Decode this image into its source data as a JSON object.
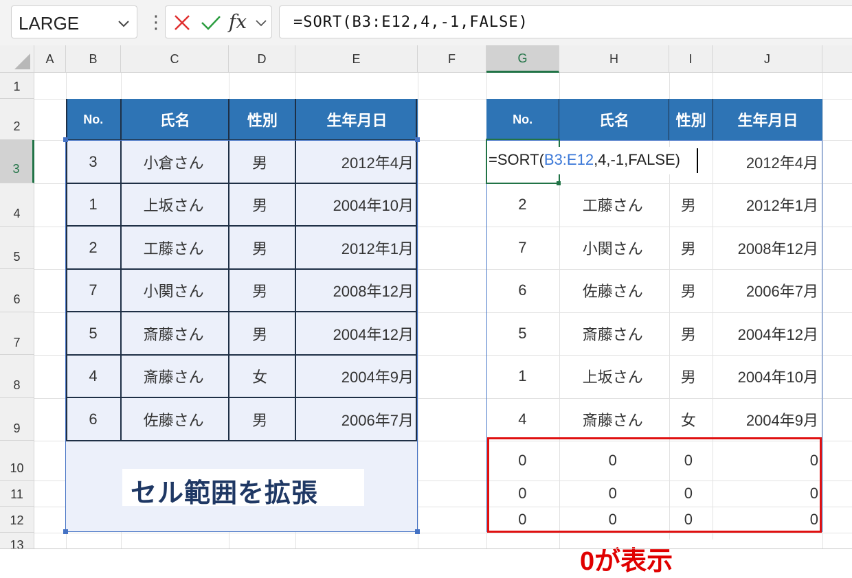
{
  "formula_bar": {
    "name_box": "LARGE",
    "fx_label": "fx",
    "formula": "=SORT(B3:E12,4,-1,FALSE)"
  },
  "columns": [
    "A",
    "B",
    "C",
    "D",
    "E",
    "F",
    "G",
    "H",
    "I",
    "J"
  ],
  "rows": [
    "1",
    "2",
    "3",
    "4",
    "5",
    "6",
    "7",
    "8",
    "9",
    "10",
    "11",
    "12",
    "13"
  ],
  "source_table": {
    "headers": [
      "No.",
      "氏名",
      "性別",
      "生年月日"
    ],
    "rows": [
      [
        "3",
        "小倉さん",
        "男",
        "2012年4月"
      ],
      [
        "1",
        "上坂さん",
        "男",
        "2004年10月"
      ],
      [
        "2",
        "工藤さん",
        "男",
        "2012年1月"
      ],
      [
        "7",
        "小関さん",
        "男",
        "2008年12月"
      ],
      [
        "5",
        "斎藤さん",
        "男",
        "2004年12月"
      ],
      [
        "4",
        "斎藤さん",
        "女",
        "2004年9月"
      ],
      [
        "6",
        "佐藤さん",
        "男",
        "2006年7月"
      ]
    ]
  },
  "result_table": {
    "headers": [
      "No.",
      "氏名",
      "性別",
      "生年月日"
    ],
    "editing": {
      "prefix": "=SORT(",
      "ref": "B3:E12",
      "suffix": ",4,-1,FALSE)",
      "e3": "2012年4月"
    },
    "rows": [
      [
        "2",
        "工藤さん",
        "男",
        "2012年1月"
      ],
      [
        "7",
        "小関さん",
        "男",
        "2008年12月"
      ],
      [
        "6",
        "佐藤さん",
        "男",
        "2006年7月"
      ],
      [
        "5",
        "斎藤さん",
        "男",
        "2004年12月"
      ],
      [
        "1",
        "上坂さん",
        "男",
        "2004年10月"
      ],
      [
        "4",
        "斎藤さん",
        "女",
        "2004年9月"
      ],
      [
        "0",
        "0",
        "0",
        "0"
      ],
      [
        "0",
        "0",
        "0",
        "0"
      ],
      [
        "0",
        "0",
        "0",
        "0"
      ]
    ]
  },
  "annotations": {
    "expand": "セル範囲を拡張",
    "zero": "0が表示"
  },
  "colors": {
    "header_fill": "#2e74b5",
    "table_fill": "#ecf0fa",
    "accent_green": "#217346",
    "highlight_red": "#e01010"
  }
}
